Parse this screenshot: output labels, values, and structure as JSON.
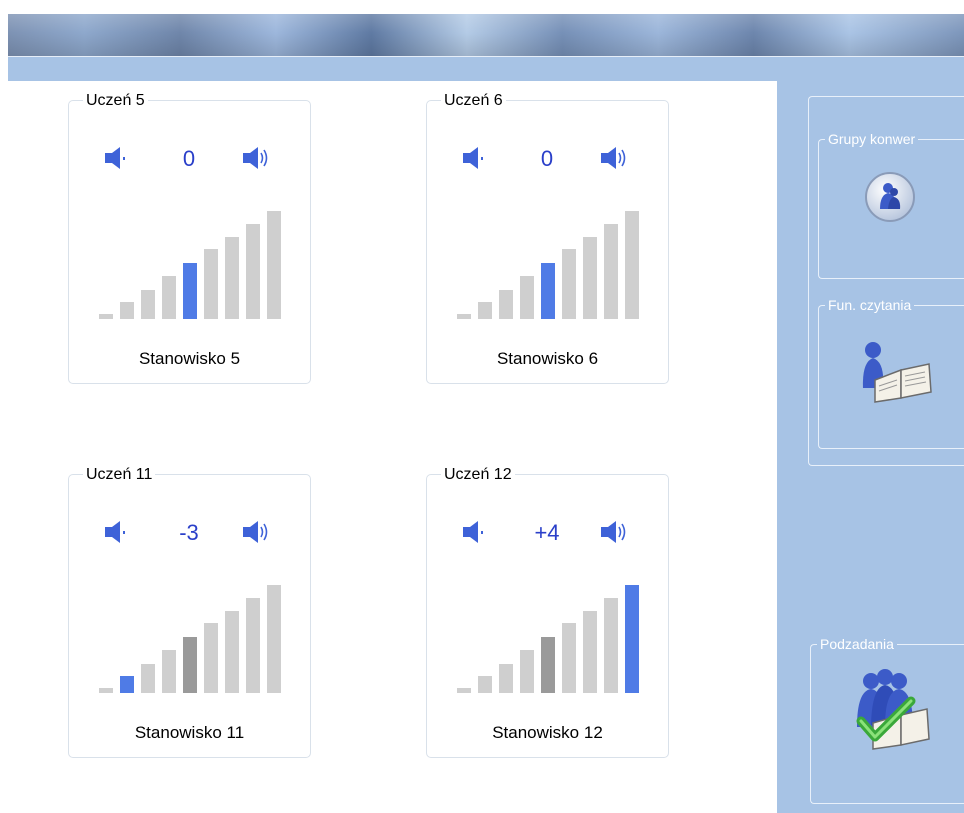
{
  "colors": {
    "panel": "#a7c3e5",
    "bar_active": "#4f7be6",
    "bar_inactive": "#cfcfcf",
    "bar_current": "#9a9a9a",
    "volume_text": "#2a3fc9",
    "speaker_icon": "#3e62d8"
  },
  "students": [
    {
      "title": "Uczeń 5",
      "volume": "0",
      "station": "Stanowisko 5",
      "level": 5,
      "current": 5
    },
    {
      "title": "Uczeń 6",
      "volume": "0",
      "station": "Stanowisko 6",
      "level": 5,
      "current": 5
    },
    {
      "title": "Uczeń 11",
      "volume": "-3",
      "station": "Stanowisko 11",
      "level": 2,
      "current": 5
    },
    {
      "title": "Uczeń 12",
      "volume": "+4",
      "station": "Stanowisko 12",
      "level": 9,
      "current": 5
    }
  ],
  "icons": {
    "volume_down": "speaker-quiet-icon",
    "volume_up": "speaker-loud-icon",
    "groups": "conversation-groups-icon",
    "reading": "reading-book-icon",
    "subtasks": "subtasks-check-icon"
  },
  "right_panel": {
    "groups_label": "Grupy konwer",
    "reading_label": "Fun. czytania",
    "subtasks_label": "Podzadania"
  }
}
